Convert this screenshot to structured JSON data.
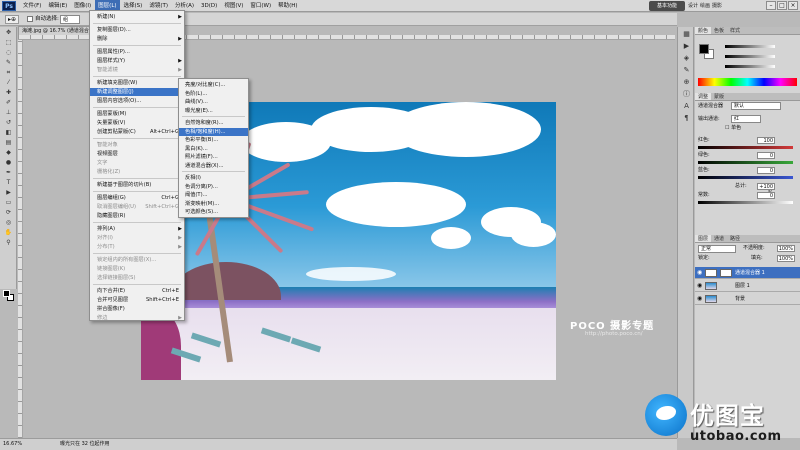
{
  "app": {
    "logo_text": "Ps"
  },
  "menubar": {
    "items": [
      "文件(F)",
      "编辑(E)",
      "图像(I)",
      "图层(L)",
      "选择(S)",
      "滤镜(T)",
      "分析(A)",
      "3D(D)",
      "视图(V)",
      "窗口(W)",
      "帮助(H)"
    ],
    "active_index": 3,
    "zoom_value": "16.7",
    "workspace_button": "基本功能",
    "workspace_links": [
      "设计",
      "绘画",
      "摄影"
    ]
  },
  "options": {
    "tool_label": "▸⊕",
    "auto_select_label": "自动选择:",
    "auto_select_value": "组"
  },
  "document": {
    "tab_title": "海滩.jpg @ 16.7% (通道混合器 1, 图层蒙版/8) ×"
  },
  "layer_menu": {
    "items": [
      {
        "label": "新建(N)",
        "shortcut": "",
        "arrow": true,
        "disabled": false
      },
      {
        "label": "复制图层(D)...",
        "shortcut": "",
        "arrow": false,
        "disabled": false
      },
      {
        "label": "删除",
        "shortcut": "",
        "arrow": true,
        "disabled": false
      },
      {
        "label": "图层属性(P)...",
        "shortcut": "",
        "arrow": false,
        "disabled": false
      },
      {
        "label": "图层样式(Y)",
        "shortcut": "",
        "arrow": true,
        "disabled": false
      },
      {
        "label": "智能滤镜",
        "shortcut": "",
        "arrow": true,
        "disabled": true
      },
      {
        "label": "新建填充图层(W)",
        "shortcut": "",
        "arrow": true,
        "disabled": false
      },
      {
        "label": "新建调整图层(J)",
        "shortcut": "",
        "arrow": true,
        "disabled": false
      },
      {
        "label": "图层内容选项(O)...",
        "shortcut": "",
        "arrow": false,
        "disabled": false
      },
      {
        "label": "图层蒙版(M)",
        "shortcut": "",
        "arrow": true,
        "disabled": false
      },
      {
        "label": "矢量蒙版(V)",
        "shortcut": "",
        "arrow": true,
        "disabled": false
      },
      {
        "label": "创建剪贴蒙版(C)",
        "shortcut": "Alt+Ctrl+G",
        "arrow": false,
        "disabled": false
      },
      {
        "label": "智能对象",
        "shortcut": "",
        "arrow": true,
        "disabled": true
      },
      {
        "label": "视频图层",
        "shortcut": "",
        "arrow": true,
        "disabled": false
      },
      {
        "label": "文字",
        "shortcut": "",
        "arrow": true,
        "disabled": true
      },
      {
        "label": "栅格化(Z)",
        "shortcut": "",
        "arrow": true,
        "disabled": true
      },
      {
        "label": "新建基于图层的切片(B)",
        "shortcut": "",
        "arrow": false,
        "disabled": false
      },
      {
        "label": "图层编组(G)",
        "shortcut": "Ctrl+G",
        "arrow": false,
        "disabled": false
      },
      {
        "label": "取消图层编组(U)",
        "shortcut": "Shift+Ctrl+G",
        "arrow": false,
        "disabled": true
      },
      {
        "label": "隐藏图层(R)",
        "shortcut": "",
        "arrow": false,
        "disabled": false
      },
      {
        "label": "排列(A)",
        "shortcut": "",
        "arrow": true,
        "disabled": false
      },
      {
        "label": "对齐(I)",
        "shortcut": "",
        "arrow": true,
        "disabled": true
      },
      {
        "label": "分布(T)",
        "shortcut": "",
        "arrow": true,
        "disabled": true
      },
      {
        "label": "锁定组内的所有图层(X)...",
        "shortcut": "",
        "arrow": false,
        "disabled": true
      },
      {
        "label": "链接图层(K)",
        "shortcut": "",
        "arrow": false,
        "disabled": true
      },
      {
        "label": "选择链接图层(S)",
        "shortcut": "",
        "arrow": false,
        "disabled": true
      },
      {
        "label": "向下合并(E)",
        "shortcut": "Ctrl+E",
        "arrow": false,
        "disabled": false
      },
      {
        "label": "合并可见图层",
        "shortcut": "Shift+Ctrl+E",
        "arrow": false,
        "disabled": false
      },
      {
        "label": "拼合图像(F)",
        "shortcut": "",
        "arrow": false,
        "disabled": false
      },
      {
        "label": "修边",
        "shortcut": "",
        "arrow": true,
        "disabled": true
      }
    ]
  },
  "adjust_submenu": {
    "items": [
      "亮度/对比度(C)...",
      "色阶(L)...",
      "曲线(V)...",
      "曝光度(E)...",
      "自然饱和度(R)...",
      "色相/饱和度(H)...",
      "色彩平衡(B)...",
      "黑白(K)...",
      "照片滤镜(F)...",
      "通道混合器(X)...",
      "反相(I)",
      "色调分离(P)...",
      "阈值(T)...",
      "渐变映射(M)...",
      "可选颜色(S)..."
    ],
    "highlight_index": 5
  },
  "panels": {
    "color_tabs": [
      "颜色",
      "色板",
      "样式"
    ],
    "adjust_tabs": [
      "调整",
      "蒙版"
    ],
    "preset_label": "通道混合器",
    "preset_value": "默认",
    "output_label": "输出通道:",
    "output_value": "红",
    "mono_label": "单色",
    "channels": [
      {
        "label": "红色:",
        "value": "100",
        "color": "#d23a3a"
      },
      {
        "label": "绿色:",
        "value": "0",
        "color": "#39a83b"
      },
      {
        "label": "蓝色:",
        "value": "0",
        "color": "#3b57d2"
      }
    ],
    "total_label": "总计:",
    "total_value": "+100 %",
    "constant_label": "常数:",
    "constant_value": "0",
    "layers_tabs": [
      "图层",
      "通道",
      "路径"
    ],
    "blend_mode": "正常",
    "opacity_label": "不透明度:",
    "opacity_value": "100%",
    "lock_label": "锁定:",
    "fill_label": "填充:",
    "fill_value": "100%",
    "layers": [
      {
        "name": "通道混合器 1",
        "selected": true
      },
      {
        "name": "图层 1",
        "selected": false
      },
      {
        "name": "背景",
        "selected": false
      }
    ]
  },
  "status": {
    "zoom": "16.67%",
    "info": "曝光只在 32 位起作用"
  },
  "canvas_watermark": {
    "title": "POCO 摄影专题",
    "url": "http://photo.poco.cn/"
  },
  "brand": {
    "cn": "优图宝",
    "en": "utobao.com"
  }
}
